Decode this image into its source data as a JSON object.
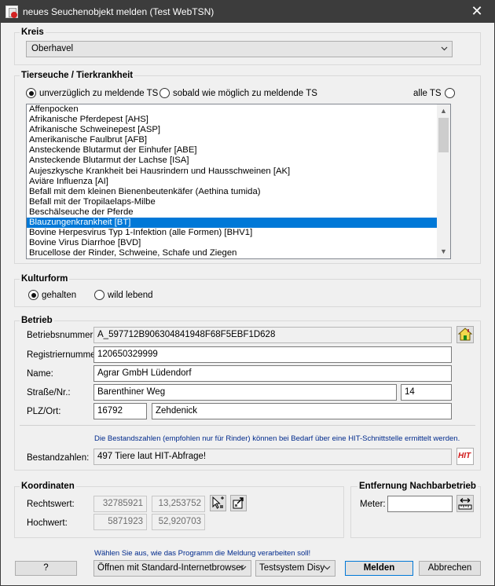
{
  "window": {
    "title": "neues Seuchenobjekt melden (Test WebTSN)"
  },
  "kreis": {
    "legend": "Kreis",
    "selected": "Oberhavel"
  },
  "tierseuche": {
    "legend": "Tierseuche / Tierkrankheit",
    "radio_immediate": "unverzüglich zu meldende TS",
    "radio_asap": "sobald wie möglich zu meldende TS",
    "radio_all": "alle TS",
    "items": [
      "Affenpocken",
      "Afrikanische Pferdepest [AHS]",
      "Afrikanische Schweinepest [ASP]",
      "Amerikanische Faulbrut [AFB]",
      "Ansteckende Blutarmut der Einhufer [ABE]",
      "Ansteckende Blutarmut der Lachse [ISA]",
      "Aujeszkysche Krankheit bei Hausrindern und Hausschweinen [AK]",
      "Aviäre Influenza [AI]",
      "Befall mit dem kleinen Bienenbeutenkäfer (Aethina tumida)",
      "Befall mit der Tropilaelaps-Milbe",
      "Beschälseuche der Pferde",
      "Blauzungenkrankheit [BT]",
      "Bovine Herpesvirus Typ 1-Infektion (alle Formen) [BHV1]",
      "Bovine Virus Diarrhoe [BVD]",
      "Brucellose der Rinder, Schweine, Schafe und Ziegen"
    ],
    "selected": "Blauzungenkrankheit [BT]"
  },
  "kulturform": {
    "legend": "Kulturform",
    "radio_kept": "gehalten",
    "radio_wild": "wild lebend"
  },
  "betrieb": {
    "legend": "Betrieb",
    "betriebsnummer_label": "Betriebsnummer:",
    "betriebsnummer_value": "A_597712B906304841948F68F5EBF1D628",
    "registriernummer_label": "Registriernummer:",
    "registriernummer_value": "120650329999",
    "name_label": "Name:",
    "name_value": "Agrar GmbH Lüdendorf",
    "strasse_label": "Straße/Nr.:",
    "strasse_value": "Barenthiner Weg",
    "nr_value": "14",
    "plz_label": "PLZ/Ort:",
    "plz_value": "16792",
    "ort_value": "Zehdenick",
    "hint": "Die Bestandszahlen (empfohlen nur für Rinder) können bei Bedarf über eine HIT-Schnittstelle ermittelt werden.",
    "bestand_label": "Bestandzahlen:",
    "bestand_value": "497 Tiere laut HIT-Abfrage!",
    "hit_icon_text": "HIT"
  },
  "koordinaten": {
    "legend": "Koordinaten",
    "rechtswert_label": "Rechtswert:",
    "rechtswert_value": "32785921",
    "rechtswert_geo": "13,253752",
    "hochwert_label": "Hochwert:",
    "hochwert_value": "5871923",
    "hochwert_geo": "52,920703"
  },
  "entfernung": {
    "legend": "Entfernung Nachbarbetrieb",
    "meter_label": "Meter:",
    "meter_value": ""
  },
  "footer": {
    "hint": "Wählen Sie aus, wie das Programm die Meldung verarbeiten soll!",
    "help_label": "?",
    "browser_option": "Öffnen mit Standard-Internetbrowser",
    "system_option": "Testsystem Disy",
    "submit_label": "Melden",
    "cancel_label": "Abbrechen"
  },
  "colors": {
    "selection": "#0078d7",
    "titlebar": "#3c3c3c",
    "hint_text": "#002a8c",
    "hit_red": "#d01818"
  }
}
